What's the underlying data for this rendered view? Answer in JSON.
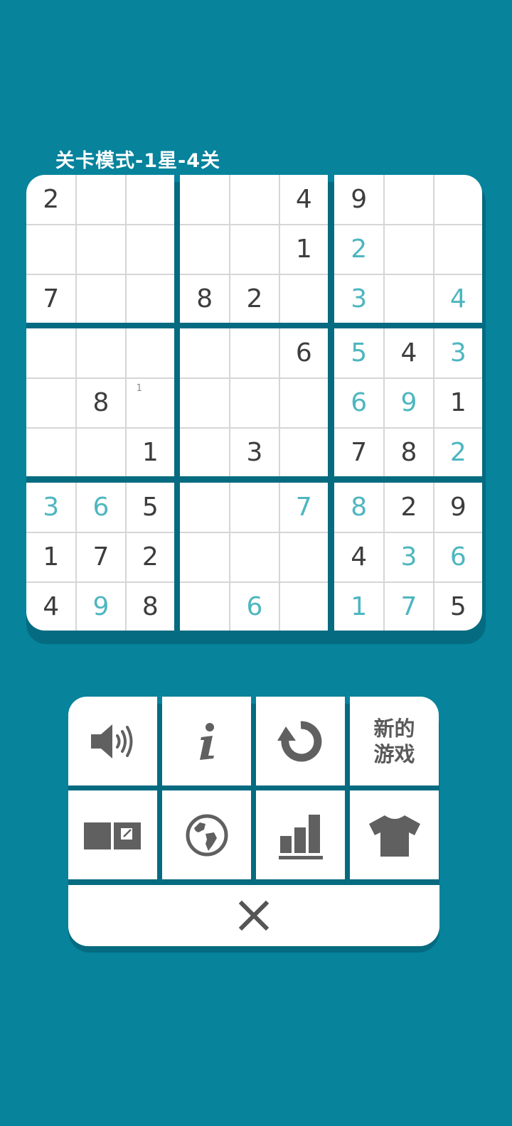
{
  "level_title": "关卡模式-1星-4关",
  "colors": {
    "background": "#07839c",
    "given": "#3d3d3d",
    "user_entry": "#4db6c0",
    "icon": "#606060"
  },
  "grid": [
    [
      "2",
      "",
      "",
      "",
      "",
      "4",
      "9",
      "",
      ""
    ],
    [
      "",
      "",
      "",
      "",
      "",
      "1",
      "2",
      "",
      ""
    ],
    [
      "7",
      "",
      "",
      "8",
      "2",
      "",
      "3",
      "",
      "4"
    ],
    [
      "",
      "",
      "",
      "",
      "",
      "6",
      "5",
      "4",
      "3"
    ],
    [
      "",
      "8",
      "",
      "",
      "",
      "",
      "6",
      "9",
      "1"
    ],
    [
      "",
      "",
      "1",
      "",
      "3",
      "",
      "7",
      "8",
      "2"
    ],
    [
      "3",
      "6",
      "5",
      "",
      "",
      "7",
      "8",
      "2",
      "9"
    ],
    [
      "1",
      "7",
      "2",
      "",
      "",
      "",
      "4",
      "3",
      "6"
    ],
    [
      "4",
      "9",
      "8",
      "",
      "6",
      "",
      "1",
      "7",
      "5"
    ]
  ],
  "user_entries": [
    [
      1,
      6
    ],
    [
      2,
      6
    ],
    [
      2,
      8
    ],
    [
      3,
      6
    ],
    [
      3,
      8
    ],
    [
      4,
      6
    ],
    [
      4,
      7
    ],
    [
      5,
      8
    ],
    [
      6,
      0
    ],
    [
      6,
      1
    ],
    [
      6,
      5
    ],
    [
      6,
      6
    ],
    [
      7,
      7
    ],
    [
      7,
      8
    ],
    [
      8,
      1
    ],
    [
      8,
      4
    ],
    [
      8,
      6
    ],
    [
      8,
      7
    ]
  ],
  "notes": [
    {
      "row": 4,
      "col": 2,
      "value": "1"
    }
  ],
  "menu": {
    "sound_icon": "speaker-volume-icon",
    "info_icon": "info-icon",
    "restart_icon": "restart-icon",
    "new_game_line1": "新的",
    "new_game_line2": "游戏",
    "notes_icon": "notes-toggle-icon",
    "globe_icon": "globe-icon",
    "stats_icon": "bar-chart-icon",
    "theme_icon": "shirt-icon",
    "close_icon": "close-icon"
  }
}
